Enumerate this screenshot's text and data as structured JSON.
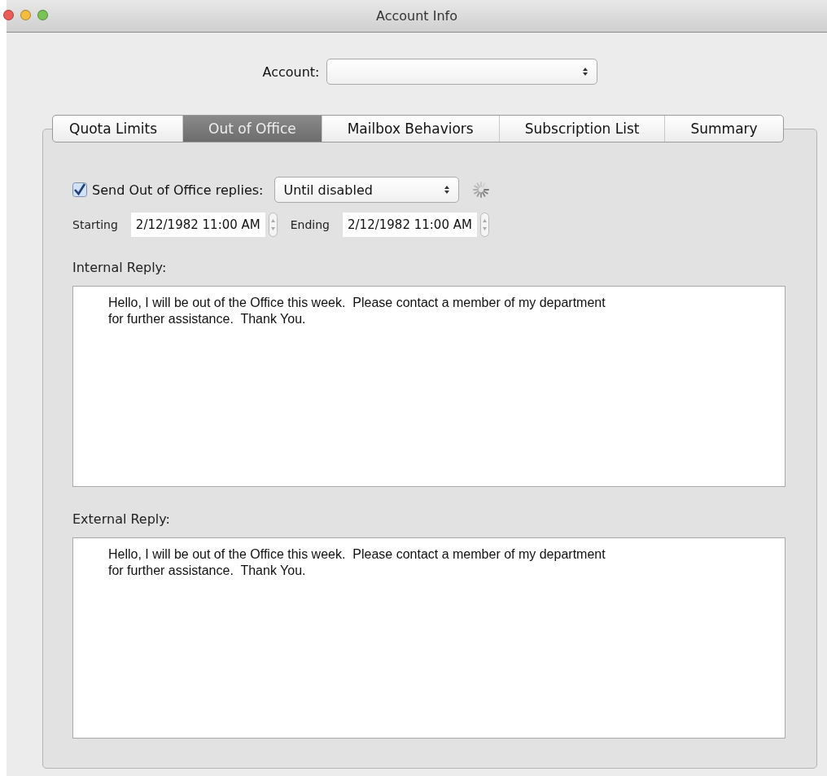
{
  "window": {
    "title": "Account Info"
  },
  "account": {
    "label": "Account:"
  },
  "tabs": [
    {
      "label": "Quota Limits",
      "selected": false
    },
    {
      "label": "Out of Office",
      "selected": true
    },
    {
      "label": "Mailbox Behaviors",
      "selected": false
    },
    {
      "label": "Subscription List",
      "selected": false
    },
    {
      "label": "Summary",
      "selected": false
    }
  ],
  "send_replies": {
    "label": "Send Out of Office replies:",
    "checked": true,
    "mode": "Until disabled",
    "busy": true
  },
  "starting": {
    "label": "Starting",
    "value": "2/12/1982 11:00 AM"
  },
  "ending": {
    "label": "Ending",
    "value": "2/12/1982 11:00 AM"
  },
  "internal_reply": {
    "label": "Internal Reply:",
    "text": "Hello, I will be out of the Office this week.  Please contact a member of my department\nfor further assistance.  Thank You."
  },
  "external_reply": {
    "label": "External Reply:",
    "text": "Hello, I will be out of the Office this week.  Please contact a member of my department\nfor further assistance.  Thank You."
  }
}
